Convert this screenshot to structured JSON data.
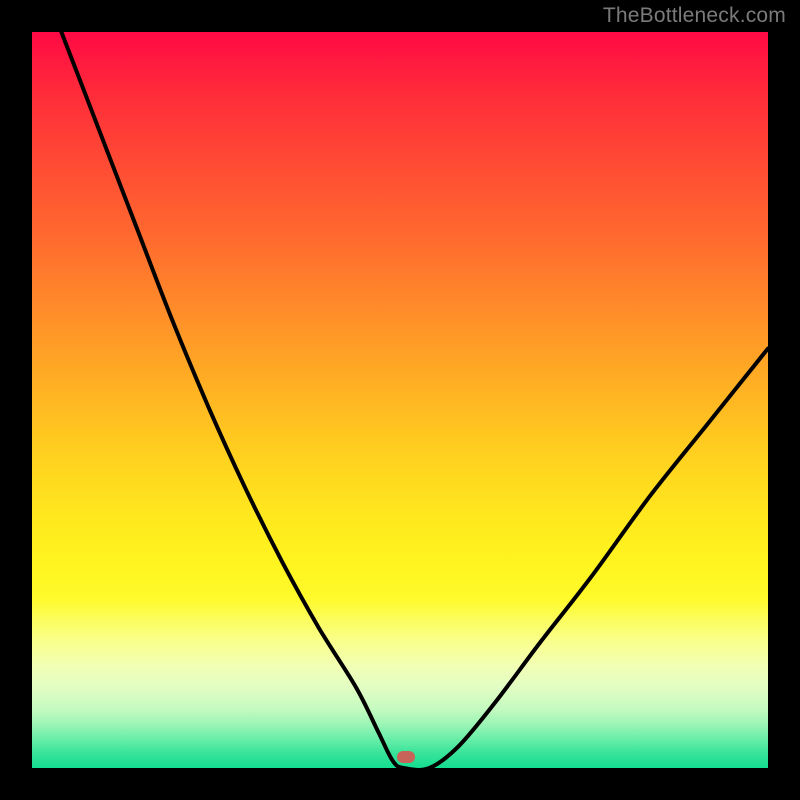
{
  "watermark": {
    "text": "TheBottleneck.com"
  },
  "colors": {
    "curve_stroke": "#000000",
    "marker_fill": "#c76358"
  },
  "marker": {
    "x_frac": 0.508,
    "y_frac": 0.985
  },
  "chart_data": {
    "type": "line",
    "title": "",
    "xlabel": "",
    "ylabel": "",
    "xlim": [
      0,
      1
    ],
    "ylim": [
      0,
      1
    ],
    "series": [
      {
        "name": "curve",
        "x": [
          0.04,
          0.09,
          0.14,
          0.19,
          0.24,
          0.29,
          0.34,
          0.39,
          0.44,
          0.47,
          0.49,
          0.505,
          0.54,
          0.58,
          0.63,
          0.69,
          0.76,
          0.84,
          0.92,
          1.0
        ],
        "y": [
          1.0,
          0.87,
          0.74,
          0.61,
          0.49,
          0.38,
          0.28,
          0.19,
          0.11,
          0.05,
          0.01,
          0.0,
          0.0,
          0.03,
          0.09,
          0.17,
          0.26,
          0.37,
          0.47,
          0.57
        ]
      }
    ]
  }
}
